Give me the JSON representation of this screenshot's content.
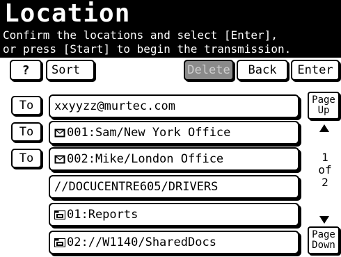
{
  "header": {
    "title": "Location",
    "line1": "Confirm the locations and select [Enter],",
    "line2": "or press [Start] to begin the transmission."
  },
  "toolbar": {
    "help_label": "?",
    "sort_label": "Sort",
    "delete_label": "Delete",
    "back_label": "Back",
    "enter_label": "Enter"
  },
  "to_label": "To",
  "destinations": [
    {
      "text": "xxyyzz@murtec.com",
      "icon": ""
    },
    {
      "text": "001:Sam/New York Office",
      "icon": "fax-icon"
    },
    {
      "text": "002:Mike/London Office",
      "icon": "fax-icon"
    },
    {
      "text": "//DOCUCENTRE605/DRIVERS",
      "icon": ""
    },
    {
      "text": "01:Reports",
      "icon": "folder-icon"
    },
    {
      "text": "02://W1140/SharedDocs",
      "icon": "folder-icon"
    }
  ],
  "pager": {
    "page_up_1": "Page",
    "page_up_2": "Up",
    "current": "1",
    "of": "of",
    "total": "2",
    "page_down_1": "Page",
    "page_down_2": "Down"
  }
}
